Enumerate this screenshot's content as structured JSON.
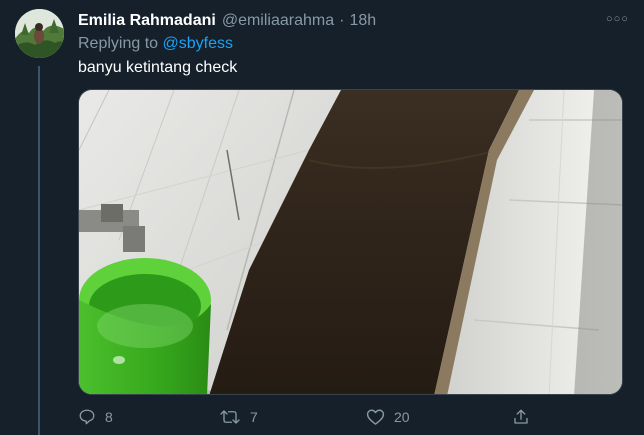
{
  "tweet": {
    "display_name": "Emilia Rahmadani",
    "handle": "@emiliaarahma",
    "separator": "·",
    "time": "18h",
    "reply_prefix": "Replying to",
    "reply_to": "@sbyfess",
    "text": "banyu ketintang check",
    "media_description_icon": "photo",
    "more_icon": "more-horizontal-icon"
  },
  "actions": {
    "reply_count": "8",
    "retweet_count": "7",
    "like_count": "20",
    "reply_icon": "comment-icon",
    "retweet_icon": "retweet-icon",
    "like_icon": "heart-icon",
    "share_icon": "share-icon"
  },
  "colors": {
    "background": "#15202b",
    "primary_text": "#ffffff",
    "secondary_text": "#8899a6",
    "accent": "#1da1f2",
    "thread_line": "#3d5466"
  }
}
